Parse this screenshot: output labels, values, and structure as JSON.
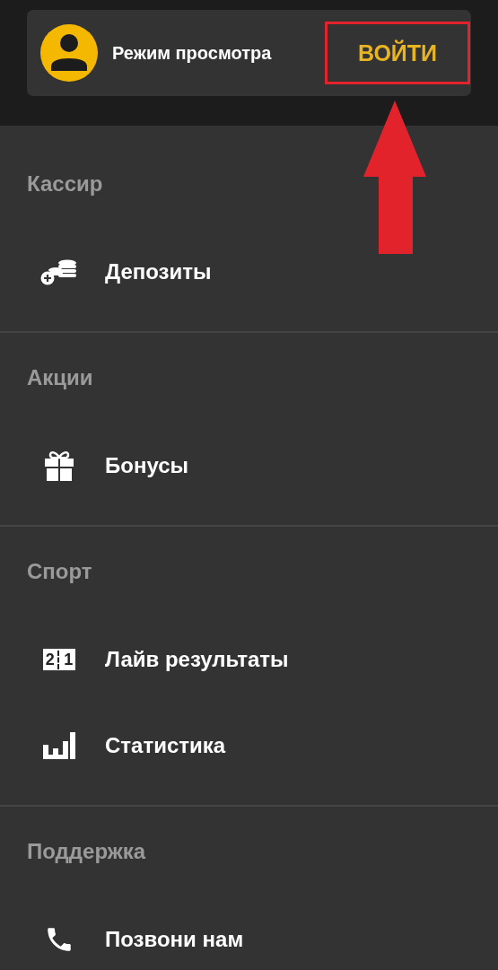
{
  "header": {
    "user_label": "Режим просмотра",
    "login_button": {
      "label": "ВОЙТИ",
      "highlighted": true
    }
  },
  "sections": [
    {
      "title": "Кассир",
      "items": [
        {
          "label": "Депозиты",
          "kind": "coins"
        }
      ]
    },
    {
      "title": "Акции",
      "items": [
        {
          "label": "Бонусы",
          "kind": "gift"
        }
      ]
    },
    {
      "title": "Спорт",
      "items": [
        {
          "label": "Лайв результаты",
          "kind": "score",
          "icon_digits": [
            "2",
            "1"
          ]
        },
        {
          "label": "Статистика",
          "kind": "bars"
        }
      ]
    },
    {
      "title": "Поддержка",
      "items": [
        {
          "label": "Позвони нам",
          "kind": "phone"
        }
      ]
    }
  ]
}
